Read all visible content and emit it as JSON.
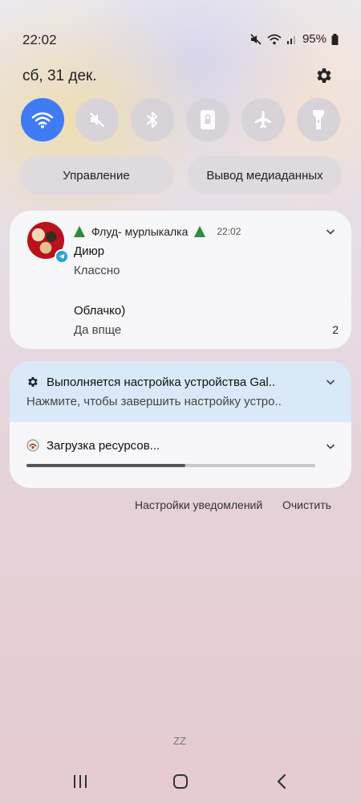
{
  "status_bar": {
    "time": "22:02",
    "battery": "95%"
  },
  "header": {
    "date": "сб, 31 дек."
  },
  "quick_toggles": [
    {
      "name": "wifi",
      "active": true
    },
    {
      "name": "sound-muted",
      "active": false
    },
    {
      "name": "bluetooth",
      "active": false
    },
    {
      "name": "rotation-lock",
      "active": false
    },
    {
      "name": "airplane-mode",
      "active": false
    },
    {
      "name": "flashlight",
      "active": false
    }
  ],
  "buttons": {
    "control": "Управление",
    "media_output": "Вывод медиаданных"
  },
  "chat_notification": {
    "title": "Флуд- мурлыкалка",
    "time": "22:02",
    "messages": [
      {
        "sender": "Диюр",
        "text": "Классно"
      },
      {
        "sender": "Облачко)",
        "text": "Да впще"
      }
    ],
    "count": "2"
  },
  "system_notification": {
    "setup_title": "Выполняется настройка устройства Gal..",
    "setup_subtitle": "Нажмите, чтобы завершить настройку устро..",
    "download_title": "Загрузка ресурсов...",
    "download_progress": 0.55
  },
  "footer": {
    "notification_settings": "Настройки уведомлений",
    "clear": "Очистить",
    "zz": "ZZ"
  },
  "colors": {
    "accent": "#3e7bf5",
    "setup_highlight": "#d9e9f7"
  }
}
